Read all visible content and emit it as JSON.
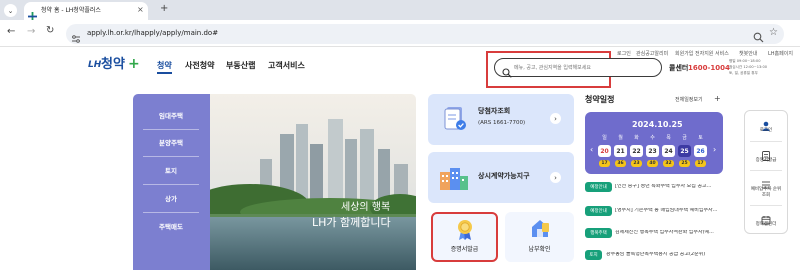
{
  "browser": {
    "tab_title": "청약 홈 - LH청약플러스",
    "new_tab": "+",
    "close": "×",
    "url": "apply.lh.or.kr/lhapply/apply/main.do#"
  },
  "header": {
    "logo_lh": "LH",
    "logo_text": "청약",
    "logo_plus": "+",
    "nav": [
      "청약",
      "사전청약",
      "부동산랩",
      "고객서비스"
    ],
    "util_links": [
      "로그인",
      "관심공고알리미",
      "회원가입",
      "전자지원 서비스",
      "챗봇안내",
      "LH홈페이지"
    ],
    "search_placeholder": "메뉴, 공고, 관심지역을 입력해보세요",
    "callcenter_label": "콜센터",
    "callcenter_number": "1600-1004",
    "hours": [
      "평일 09:00~18:00",
      "점심시간 12:00~13:00",
      "토, 일, 공휴일 휴무"
    ]
  },
  "sidebar": {
    "items": [
      "임대주택",
      "분양주택",
      "토지",
      "상가",
      "주택매도"
    ]
  },
  "hero": {
    "line1": "세상의 행복",
    "line2": "LH가 함께합니다"
  },
  "cards": {
    "winner": {
      "title": "당첨자조회",
      "sub": "(ARS 1661-7700)"
    },
    "contract": {
      "title": "상시계약가능지구"
    },
    "certificate": {
      "title": "증명서발급"
    },
    "payment": {
      "title": "납부확인"
    }
  },
  "schedule": {
    "title": "청약일정",
    "more": "전체일정보기",
    "date": "2024.10.25",
    "days": [
      "일",
      "월",
      "화",
      "수",
      "목",
      "금",
      "토"
    ],
    "dates": [
      "20",
      "21",
      "22",
      "23",
      "24",
      "25",
      "26"
    ],
    "counts": [
      "17",
      "36",
      "23",
      "40",
      "32",
      "25",
      "17"
    ]
  },
  "news": [
    {
      "badge": "예정안내",
      "text": "[인천 중구] 청년 특화주택 입주자 모집 공고..."
    },
    {
      "badge": "예정안내",
      "text": "[영주시] 기존주택 등 매입임대주택 예비입주자..."
    },
    {
      "badge": "행복주택",
      "text": "김제제진신 행복주택 입주자격완화 입주자(예..."
    },
    {
      "badge": "토지",
      "text": "광주동남 블록형단독주택용지 공급 공고(2순위)"
    }
  ],
  "quick": {
    "items": [
      "로그인",
      "증명서발급",
      "예비입주자 순위 조회",
      "청약캘린더"
    ]
  },
  "colors": {
    "brand_blue": "#1a4e9f",
    "brand_green": "#32a84b",
    "sidebar": "#7c7fd0",
    "highlight_red": "#d83c3c",
    "calendar": "#6f6ccc"
  }
}
